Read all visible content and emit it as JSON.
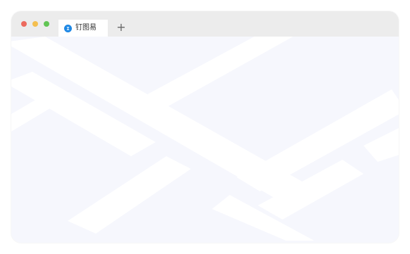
{
  "colors": {
    "page_bg": "#ffffff",
    "window_bg": "#f6f7fd",
    "titlebar_bg": "#ececec",
    "traffic_close": "#ec6a5e",
    "traffic_minimize": "#f4bf4f",
    "traffic_maximize": "#61c554",
    "tab_icon": "#1e88e5",
    "decor_lines": "#ffffff"
  },
  "tabs": [
    {
      "icon": "app-logo-icon",
      "label": "钉图易"
    }
  ],
  "new_tab": {
    "icon": "plus-icon",
    "label": "+"
  }
}
